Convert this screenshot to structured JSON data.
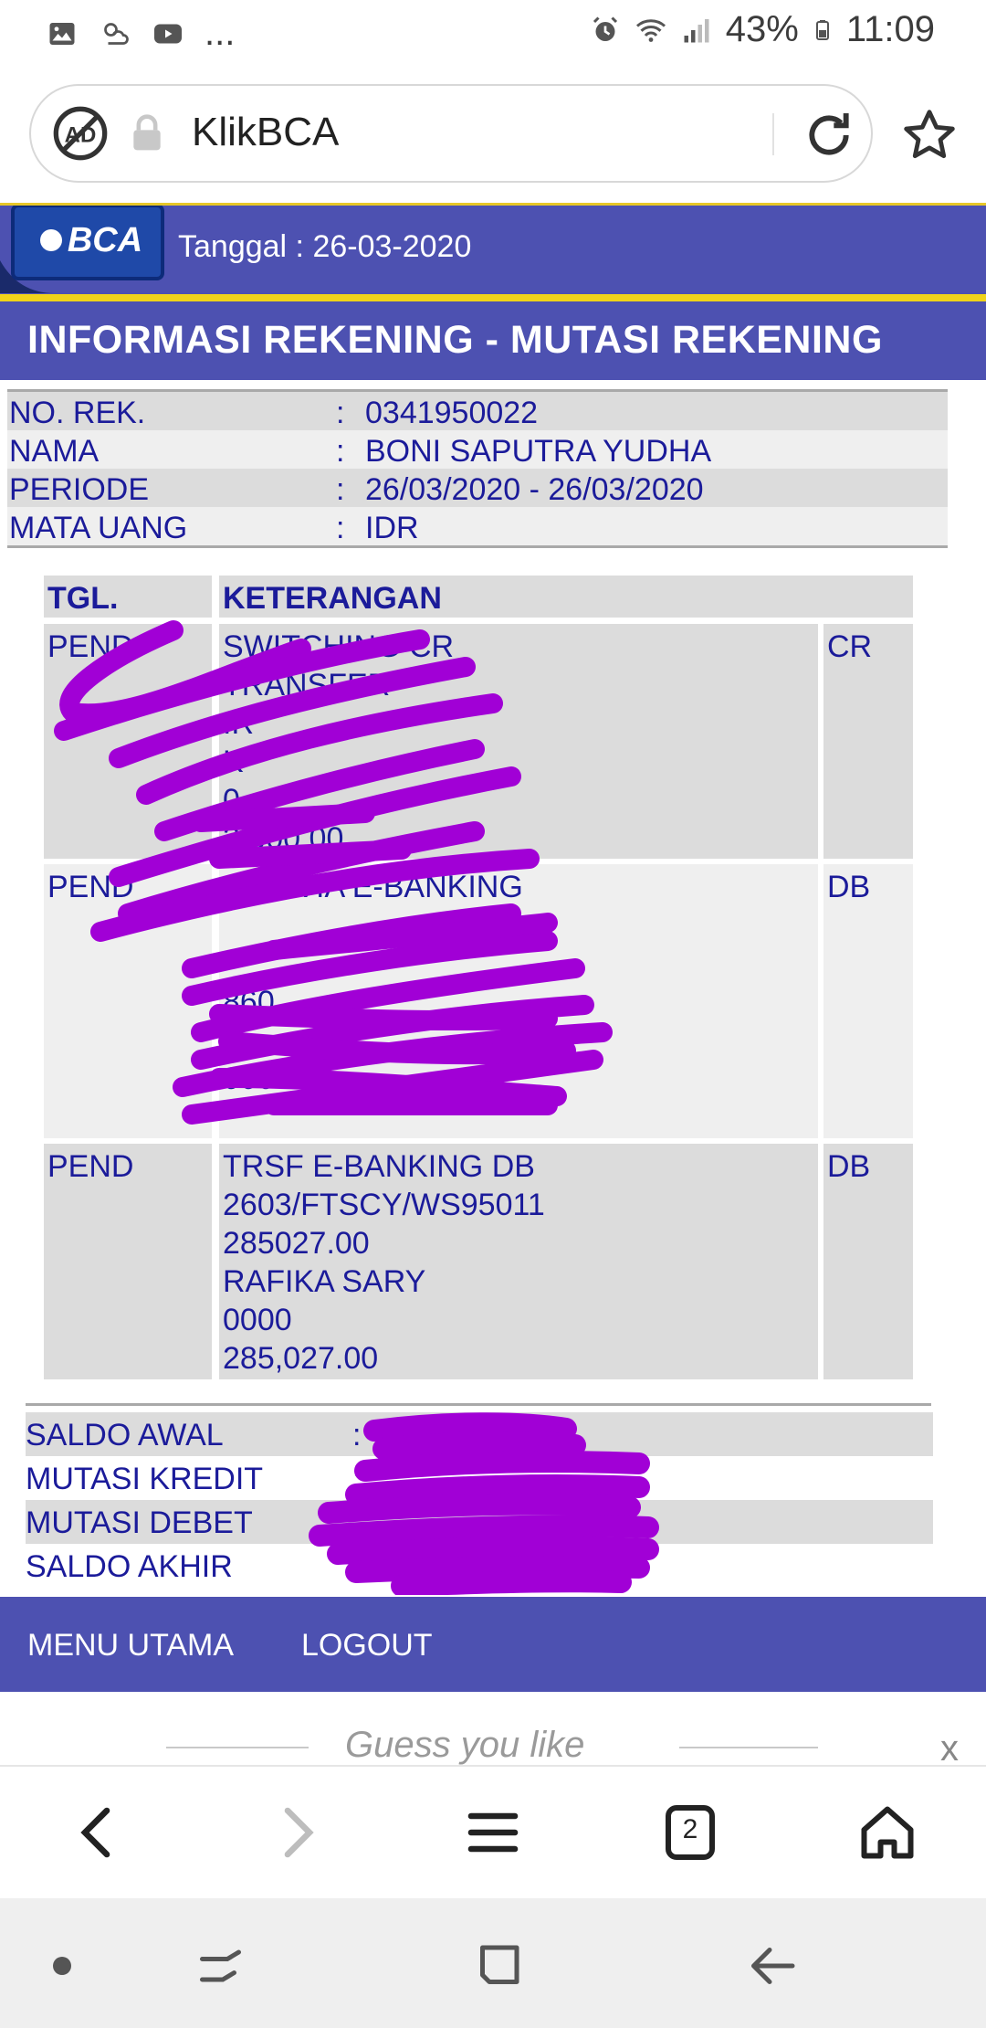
{
  "status_bar": {
    "battery": "43%",
    "time": "11:09",
    "more": "..."
  },
  "browser": {
    "url_title": "KlikBCA",
    "tab_count": "2"
  },
  "header": {
    "logo_text": "BCA",
    "date_label": "Tanggal : 26-03-2020",
    "page_title": "INFORMASI REKENING - MUTASI REKENING"
  },
  "account": {
    "rows": [
      {
        "label": "NO. REK.",
        "sep": ":",
        "value": "0341950022"
      },
      {
        "label": "NAMA",
        "sep": ":",
        "value": "BONI SAPUTRA YUDHA"
      },
      {
        "label": "PERIODE",
        "sep": ":",
        "value": "26/03/2020 - 26/03/2020"
      },
      {
        "label": "MATA UANG",
        "sep": ":",
        "value": "IDR"
      }
    ]
  },
  "mutations": {
    "headers": {
      "date": "TGL.",
      "desc": "KETERANGAN"
    },
    "rows": [
      {
        "date": "PEND",
        "desc_lines": [
          "SWITCHING CR",
          "TRANSFER",
          "IR",
          "K",
          "0",
          "2,000.00"
        ],
        "type": "CR"
      },
      {
        "date": "PEND",
        "desc_lines": [
          "BYR VIA E-BANKING",
          "",
          "",
          "860",
          "",
          "000"
        ],
        "type": "DB"
      },
      {
        "date": "PEND",
        "desc_lines": [
          "TRSF E-BANKING DB",
          "2603/FTSCY/WS95011",
          "285027.00",
          "RAFIKA SARY",
          "0000",
          "285,027.00"
        ],
        "type": "DB"
      }
    ]
  },
  "summary": {
    "rows": [
      {
        "label": "SALDO AWAL",
        "sep": ":"
      },
      {
        "label": "MUTASI KREDIT",
        "sep": ":"
      },
      {
        "label": "MUTASI DEBET",
        "sep": ":"
      },
      {
        "label": "SALDO AKHIR",
        "sep": ":"
      }
    ]
  },
  "footer_nav": {
    "menu_label": "MENU UTAMA",
    "logout_label": "LOGOUT"
  },
  "recommend": {
    "title": "Guess you like",
    "close": "x"
  },
  "colors": {
    "brand_blue": "#4d51b1",
    "brand_yellow": "#f0d31a",
    "text_blue": "#1b1b9a",
    "redaction_purple": "#a100d6"
  }
}
